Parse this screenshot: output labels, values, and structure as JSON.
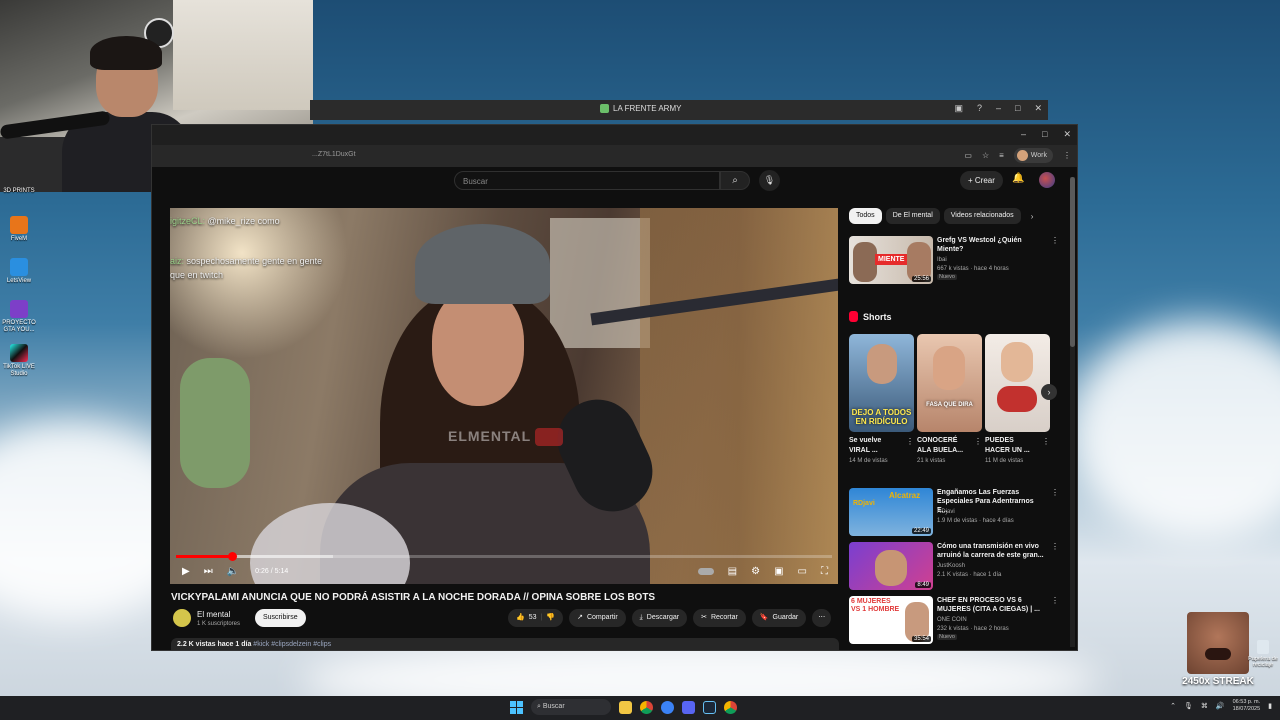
{
  "desktop": {
    "icons": [
      {
        "label": "3D PRINTS",
        "color": "#6b7c8c"
      },
      {
        "label": "FiveM",
        "color": "#e8751a"
      },
      {
        "label": "LetsView",
        "color": "#2a8fe0"
      },
      {
        "label": "PROYECTO GTA YOU...",
        "color": "#7d3fc8"
      },
      {
        "label": "TikTok LIVE Studio",
        "color": "#111111"
      }
    ],
    "streak_label": "2450x STREAK",
    "recycle_label": "Papelera de reciclaje"
  },
  "back_window": {
    "title": "LA FRENTE ARMY"
  },
  "browser": {
    "url": "...Z7tL1DuxGt",
    "profile": "Work"
  },
  "youtube": {
    "search_placeholder": "Buscar",
    "create_label": "Crear",
    "player": {
      "chat": [
        {
          "user": "igitzeCL:",
          "text": "@mike_rize como"
        },
        {
          "user": "aiz:",
          "text": "sospechosamente gente en gente que en twitch"
        }
      ],
      "watermark": "ELMENTAL",
      "time": "0:26 / 5:14",
      "progress": 0.085
    },
    "video_title": "VICKYPALAMI ANUNCIA QUE NO PODRÁ ASISTIR A LA NOCHE DORADA // OPINA SOBRE LOS BOTS",
    "channel": {
      "name": "El mental",
      "subs": "1 K suscriptores",
      "subscribe_label": "Suscribirse"
    },
    "actions": {
      "likes": "53",
      "share": "Compartir",
      "download": "Descargar",
      "clip": "Recortar",
      "save": "Guardar"
    },
    "description": {
      "views": "2.2 K vistas",
      "age": "hace 1 día",
      "tags": "#kick #clipsdelzein #clips"
    },
    "sidebar": {
      "chips": [
        "Todos",
        "De El mental",
        "Videos relacionados"
      ],
      "first_video": {
        "title": "Grefg VS Westcol ¿Quién Miente?",
        "channel": "Ibai",
        "meta": "667 k vistas · hace 4 horas",
        "badge": "Nuevo",
        "duration": "25:56",
        "thumb_caption": "MIENTE"
      },
      "shorts_title": "Shorts",
      "shorts": [
        {
          "title": "Se vuelve VIRAL ...",
          "views": "14 M de vistas",
          "caption": "DEJO A TODOS EN RIDÍCULO",
          "color1": "#8fb6d9",
          "color2": "#3b5a7a"
        },
        {
          "title": "CONOCERÉ ALA BUELA...",
          "views": "21 k vistas",
          "caption": "FASA QUE DIRA",
          "color1": "#e9c7b0",
          "color2": "#b7856b"
        },
        {
          "title": "PUEDES HACER UN ...",
          "views": "11 M de vistas",
          "caption": "",
          "color1": "#f3ece6",
          "color2": "#c2312e"
        }
      ],
      "videos": [
        {
          "title": "Engañamos Las Fuerzas Especiales Para Adentrarnos E...",
          "channel": "RDjavi",
          "meta": "1.9 M de vistas · hace 4 días",
          "duration": "22:49",
          "thumb_caption": "Alcatraz",
          "color1": "#2f86d6",
          "color2": "#f2b400"
        },
        {
          "title": "Cómo una transmisión en vivo arruinó la carrera de este gran...",
          "channel": "JustKoosh",
          "meta": "2.1 K vistas · hace 1 día",
          "duration": "8:49",
          "thumb_caption": "",
          "color1": "#7a3fd0",
          "color2": "#d04090"
        },
        {
          "title": "CHEF EN PROCESO VS 6 MUJERES (CITA A CIEGAS) | ...",
          "channel": "ONE COIN",
          "meta": "232 k vistas · hace 2 horas",
          "duration": "35:54",
          "thumb_caption": "6 MUJERES VS 1 HOMBRE",
          "color1": "#ffffff",
          "color2": "#e13b3b",
          "badge": "Nuevo"
        }
      ]
    }
  },
  "taskbar": {
    "search_placeholder": "Buscar",
    "time": "06:53 p. m.",
    "date": "18/07/2025"
  }
}
